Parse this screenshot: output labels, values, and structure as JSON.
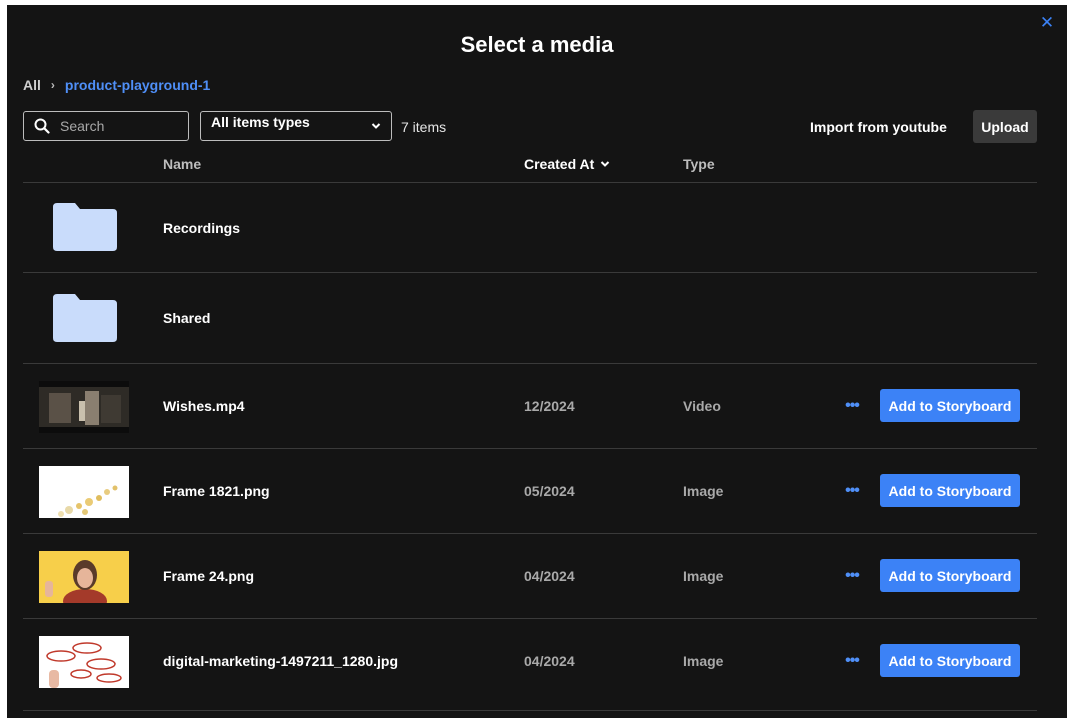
{
  "modal": {
    "title": "Select a media",
    "close_icon": "close-icon"
  },
  "breadcrumb": {
    "root": "All",
    "separator": "›",
    "current": "product-playground-1"
  },
  "toolbar": {
    "search_placeholder": "Search",
    "type_filter": "All items types",
    "item_count": "7 items",
    "import_label": "Import from youtube",
    "upload_label": "Upload"
  },
  "columns": {
    "name": "Name",
    "created_at": "Created At",
    "type": "Type"
  },
  "folders": [
    {
      "name": "Recordings",
      "icon": "folder-icon"
    },
    {
      "name": "Shared",
      "icon": "folder-icon"
    }
  ],
  "files": [
    {
      "name": "Wishes.mp4",
      "date": "12/2024",
      "type": "Video",
      "action": "Add to Storyboard",
      "more": "•••"
    },
    {
      "name": "Frame 1821.png",
      "date": "05/2024",
      "type": "Image",
      "action": "Add to Storyboard",
      "more": "•••"
    },
    {
      "name": "Frame 24.png",
      "date": "04/2024",
      "type": "Image",
      "action": "Add to Storyboard",
      "more": "•••"
    },
    {
      "name": "digital-marketing-1497211_1280.jpg",
      "date": "04/2024",
      "type": "Image",
      "action": "Add to Storyboard",
      "more": "•••"
    }
  ],
  "colors": {
    "background": "#141414",
    "accent": "#3c82f6",
    "folder": "#c9dcfb",
    "divider": "#3a3a3a"
  }
}
